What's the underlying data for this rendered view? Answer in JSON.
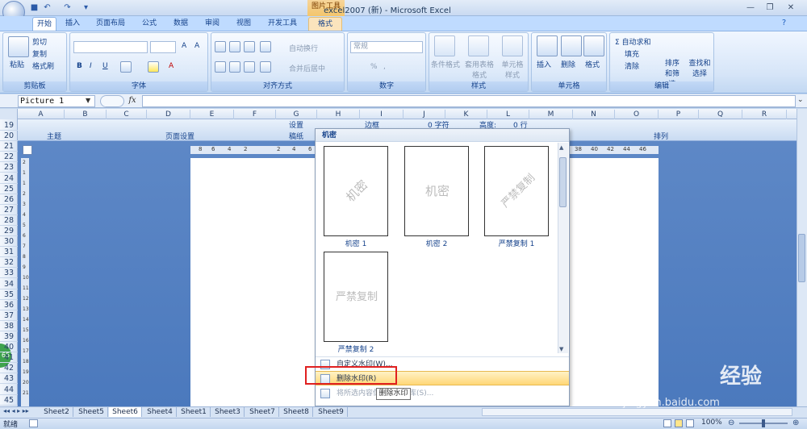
{
  "window": {
    "title": "excel2007 (新) - Microsoft Excel",
    "context_tool": "图片工具"
  },
  "tabs": [
    "开始",
    "插入",
    "页面布局",
    "公式",
    "数据",
    "审阅",
    "视图",
    "开发工具",
    "格式"
  ],
  "ribbon": {
    "clipboard": {
      "label": "剪贴板",
      "paste": "粘贴",
      "cut": "剪切",
      "copy": "复制",
      "format_painter": "格式刷"
    },
    "font": {
      "label": "字体",
      "bold": "B",
      "italic": "I",
      "underline": "U",
      "grow": "A",
      "shrink": "A",
      "color": "A"
    },
    "alignment": {
      "label": "对齐方式",
      "wrap": "自动换行",
      "merge": "合并后居中"
    },
    "number": {
      "label": "数字",
      "format": "常规",
      "percent": "%",
      "comma": ","
    },
    "styles": {
      "label": "样式",
      "conditional": "条件格式",
      "table": "套用表格格式",
      "cell_styles": "单元格样式"
    },
    "cells": {
      "label": "单元格",
      "insert": "插入",
      "delete": "删除",
      "format": "格式"
    },
    "editing": {
      "label": "编辑",
      "autosum": "Σ 自动求和",
      "fill": "填充",
      "clear": "清除",
      "sort_filter": "排序和筛选",
      "find_select": "查找和选择"
    }
  },
  "formula": {
    "name_box": "Picture 1",
    "fx": "fx",
    "value": ""
  },
  "columns": [
    "A",
    "B",
    "C",
    "D",
    "E",
    "F",
    "G",
    "H",
    "I",
    "J",
    "K",
    "L",
    "M",
    "N",
    "O",
    "P",
    "Q",
    "R"
  ],
  "rows": [
    "19",
    "20",
    "21",
    "22",
    "23",
    "24",
    "25",
    "26",
    "27",
    "28",
    "29",
    "30",
    "31",
    "32",
    "33",
    "34",
    "35",
    "36",
    "37",
    "38",
    "39",
    "40",
    "41",
    "42",
    "43",
    "44",
    "45"
  ],
  "page_layout_band": {
    "theme": "主题",
    "page_setup": "页面设置",
    "scale": "稿纸",
    "arrange": "排列",
    "setting": "设置",
    "margin": "边框",
    "width": "0 字符",
    "height": "高度:",
    "rows": "0 行"
  },
  "ruler_top": [
    "8",
    "6",
    "4",
    "2",
    "2",
    "4",
    "6",
    "38",
    "40",
    "42",
    "44",
    "46"
  ],
  "ruler_left": [
    "2",
    "1",
    "1",
    "2",
    "3",
    "4",
    "5",
    "6",
    "7",
    "8",
    "9",
    "10",
    "11",
    "12",
    "13",
    "14",
    "15",
    "16",
    "17",
    "18",
    "19",
    "20",
    "21"
  ],
  "gallery": {
    "header": "机密",
    "items": [
      {
        "caption": "机密 1",
        "mark": "机密"
      },
      {
        "caption": "机密 2",
        "mark": "机密"
      },
      {
        "caption": "严禁复制 1",
        "mark": "严禁复制"
      },
      {
        "caption": "严禁复制 2",
        "mark": "严禁复制"
      }
    ],
    "menu": {
      "custom": "自定义水印(W)...",
      "remove": "删除水印(R)",
      "save": "将所选内容保存到水印库(S)..."
    },
    "tooltip": "删除水印"
  },
  "sheets": [
    "Sheet2",
    "Sheet5",
    "Sheet6",
    "Sheet4",
    "Sheet1",
    "Sheet3",
    "Sheet7",
    "Sheet8",
    "Sheet9"
  ],
  "active_sheet": "Sheet6",
  "status": {
    "ready": "就绪",
    "zoom": "100%"
  },
  "badge": "65",
  "brand": {
    "line1": "Bai",
    "line2": "经验",
    "line3": "jingyan.baidu.com"
  }
}
